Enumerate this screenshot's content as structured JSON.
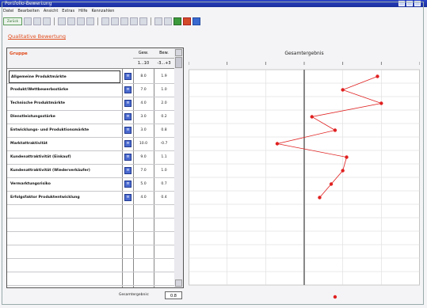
{
  "window": {
    "title": "Portfolio-Bewertung"
  },
  "menu": [
    "Datei",
    "Bearbeiten",
    "Ansicht",
    "Extras",
    "Hilfe",
    "Kennzahlen"
  ],
  "toolbar": {
    "start_label": "Zurück"
  },
  "section_link": "Qualitative Bewertung",
  "table": {
    "header_group": "Gruppe",
    "col_a": {
      "label": "Gew.",
      "range": "1...10"
    },
    "col_b": {
      "label": "Bew.",
      "range": "-3...+3"
    },
    "rows": [
      {
        "name": "Allgemeine Produktmärkte",
        "a": "8.0",
        "b": "1.9"
      },
      {
        "name": "Produkt/Wettbewerbsstärke",
        "a": "7.0",
        "b": "1.0"
      },
      {
        "name": "Technische Produktmärkte",
        "a": "4.0",
        "b": "2.0"
      },
      {
        "name": "Dienstleistungsstärke",
        "a": "3.0",
        "b": "0.2"
      },
      {
        "name": "Entwicklungs- und Produktionsmärkte",
        "a": "3.0",
        "b": "0.8"
      },
      {
        "name": "Marktattraktivität",
        "a": "10.0",
        "b": "-0.7"
      },
      {
        "name": "Kundenattraktivität (Einkauf)",
        "a": "9.0",
        "b": "1.1"
      },
      {
        "name": "Kundenattraktivität (Wiederverkäufer)",
        "a": "7.0",
        "b": "1.0"
      },
      {
        "name": "Vermarktungsrisiko",
        "a": "5.0",
        "b": "0.7"
      },
      {
        "name": "Erfolgsfaktor Produktentwicklung",
        "a": "4.0",
        "b": "0.4"
      }
    ],
    "footer_label": "Gesamtergebnis:",
    "footer_value": "0.8"
  },
  "chart_data": {
    "type": "line",
    "title": "Gesamtergebnis",
    "xlim": [
      -3,
      3
    ],
    "x_ticks": [
      -3,
      -2,
      -1,
      0,
      1,
      2,
      3
    ],
    "categories": [
      "Allgemeine Produktmärkte",
      "Produkt/Wettbewerbsstärke",
      "Technische Produktmärkte",
      "Dienstleistungsstärke",
      "Entwicklungs- und Produktionsmärkte",
      "Marktattraktivität",
      "Kundenattraktivität (Einkauf)",
      "Kundenattraktivität (Wiederverkäufer)",
      "Vermarktungsrisiko",
      "Erfolgsfaktor Produktentwicklung"
    ],
    "values": [
      1.9,
      1.0,
      2.0,
      0.2,
      0.8,
      -0.7,
      1.1,
      1.0,
      0.7,
      0.4
    ],
    "total": 0.8,
    "line_color": "#e02020",
    "marker_color": "#e02020",
    "zero_line_color": "#888888",
    "grid": true
  }
}
